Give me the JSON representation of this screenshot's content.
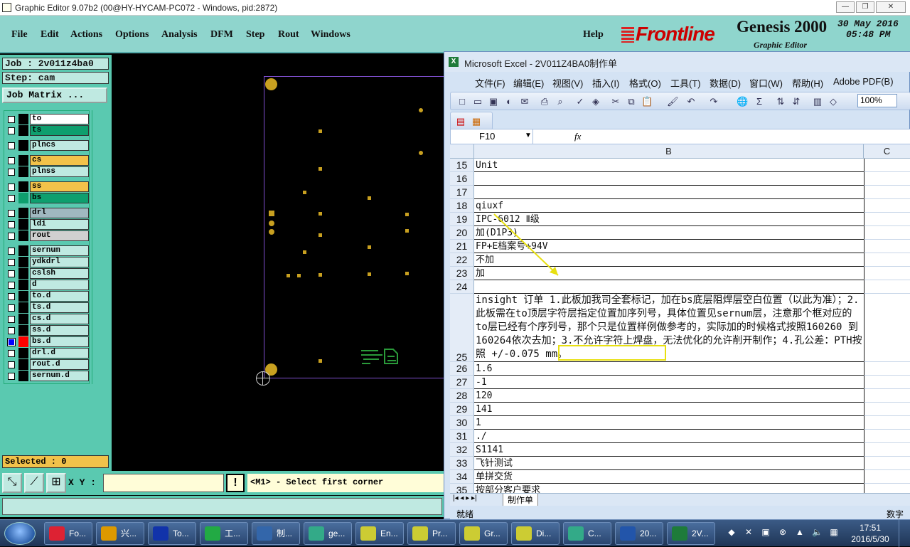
{
  "genesis": {
    "title": "Graphic Editor 9.07b2 (00@HY-HYCAM-PC072 - Windows, pid:2872)",
    "menu": [
      "File",
      "Edit",
      "Actions",
      "Options",
      "Analysis",
      "DFM",
      "Step",
      "Rout",
      "Windows"
    ],
    "help": "Help",
    "logo_text": "Frontline",
    "product": "Genesis 2000",
    "subtitle": "Graphic Editor",
    "date": "30 May 2016",
    "time": "05:48 PM",
    "job": "Job : 2v011z4ba0",
    "step": "Step: cam",
    "job_matrix": "Job Matrix ...",
    "layers": [
      {
        "name": "to",
        "color": "#ffffff",
        "swatch": "#000000"
      },
      {
        "name": "ts",
        "color": "#0e9f6e",
        "swatch": "#000000"
      },
      {
        "name": "plncs",
        "color": "#bfe9e1",
        "swatch": "#000000"
      },
      {
        "name": "cs",
        "color": "#f2c24a",
        "swatch": "#000000"
      },
      {
        "name": "plnss",
        "color": "#bfe9e1",
        "swatch": "#000000"
      },
      {
        "name": "ss",
        "color": "#f2c24a",
        "swatch": "#000000"
      },
      {
        "name": "bs",
        "color": "#0e9f6e",
        "swatch": "#0e9f6e"
      },
      {
        "name": "drl",
        "color": "#a0b8c0",
        "swatch": "#000000"
      },
      {
        "name": "ldi",
        "color": "#bfe9e1",
        "swatch": "#000000"
      },
      {
        "name": "rout",
        "color": "#d0d0d0",
        "swatch": "#000000"
      },
      {
        "name": "sernum",
        "color": "#bfe9e1",
        "swatch": "#000000"
      },
      {
        "name": "ydkdrl",
        "color": "#bfe9e1",
        "swatch": "#000000"
      },
      {
        "name": "cslsh",
        "color": "#bfe9e1",
        "swatch": "#000000"
      },
      {
        "name": "d",
        "color": "#bfe9e1",
        "swatch": "#000000"
      },
      {
        "name": "to.d",
        "color": "#bfe9e1",
        "swatch": "#000000"
      },
      {
        "name": "ts.d",
        "color": "#bfe9e1",
        "swatch": "#000000"
      },
      {
        "name": "cs.d",
        "color": "#bfe9e1",
        "swatch": "#000000"
      },
      {
        "name": "ss.d",
        "color": "#bfe9e1",
        "swatch": "#000000"
      },
      {
        "name": "bs.d",
        "color": "#bfe9e1",
        "swatch": "#ff0000",
        "checked": true
      },
      {
        "name": "drl.d",
        "color": "#bfe9e1",
        "swatch": "#000000"
      },
      {
        "name": "rout.d",
        "color": "#bfe9e1",
        "swatch": "#000000"
      },
      {
        "name": "sernum.d",
        "color": "#bfe9e1",
        "swatch": "#000000"
      }
    ],
    "selected": "Selected : 0",
    "xy_label": "X Y :",
    "prompt_btn": "!",
    "message": "<M1> - Select first corner"
  },
  "excel": {
    "title": "Microsoft Excel - 2V011Z4BA0制作单",
    "menu": [
      "文件(F)",
      "编辑(E)",
      "视图(V)",
      "插入(I)",
      "格式(O)",
      "工具(T)",
      "数据(D)",
      "窗口(W)",
      "帮助(H)",
      "Adobe PDF(B)"
    ],
    "zoom": "100%",
    "name_box": "F10",
    "fx": "fx",
    "col_b": "B",
    "col_c": "C",
    "rows": [
      {
        "n": "15",
        "v": "Unit"
      },
      {
        "n": "16",
        "v": ""
      },
      {
        "n": "17",
        "v": ""
      },
      {
        "n": "18",
        "v": "qiuxf"
      },
      {
        "n": "19",
        "v": "IPC-6012 Ⅱ级"
      },
      {
        "n": "20",
        "v": "加(D1P3)"
      },
      {
        "n": "21",
        "v": "FP+E档案号+94V"
      },
      {
        "n": "22",
        "v": "不加"
      },
      {
        "n": "23",
        "v": "加"
      },
      {
        "n": "24",
        "v": ""
      },
      {
        "n": "25",
        "v": "insight 订单 1.此板加我司全套标记，加在bs底层阻焊层空白位置（以此为准）；2.此板需在to顶层字符层指定位置加序列号，具体位置见sernum层，注意那个框对应的to层已经有个序列号，那个只是位置样例做参考的，实际加的时候格式按照160260 到 160264依次去加；3.不允许字符上焊盘，无法优化的允许削开制作；4.孔公差：PTH按照 +/-0.075 mm。"
      },
      {
        "n": "26",
        "v": "1.6"
      },
      {
        "n": "27",
        "v": "-1"
      },
      {
        "n": "28",
        "v": "120"
      },
      {
        "n": "29",
        "v": "141"
      },
      {
        "n": "30",
        "v": "1"
      },
      {
        "n": "31",
        "v": "./"
      },
      {
        "n": "32",
        "v": "S1141"
      },
      {
        "n": "33",
        "v": "飞针测试"
      },
      {
        "n": "34",
        "v": "单拼交货"
      },
      {
        "n": "35",
        "v": "按部分客户要求"
      }
    ],
    "sheet_tab": "制作单",
    "status_left": "就绪",
    "status_right": "数字"
  },
  "taskbar": {
    "items": [
      {
        "label": "Fo...",
        "color": "#d23"
      },
      {
        "label": "兴...",
        "color": "#d90"
      },
      {
        "label": "To...",
        "color": "#13a"
      },
      {
        "label": "工...",
        "color": "#2a4"
      },
      {
        "label": "制...",
        "color": "#36a"
      },
      {
        "label": "ge...",
        "color": "#3a8"
      },
      {
        "label": "En...",
        "color": "#cc3"
      },
      {
        "label": "Pr...",
        "color": "#cc3"
      },
      {
        "label": "Gr...",
        "color": "#cc3"
      },
      {
        "label": "Di...",
        "color": "#cc3"
      },
      {
        "label": "C...",
        "color": "#3a8"
      },
      {
        "label": "20...",
        "color": "#25a"
      },
      {
        "label": "2V...",
        "color": "#1e7b3a"
      }
    ],
    "time": "17:51",
    "date": "2016/5/30"
  }
}
